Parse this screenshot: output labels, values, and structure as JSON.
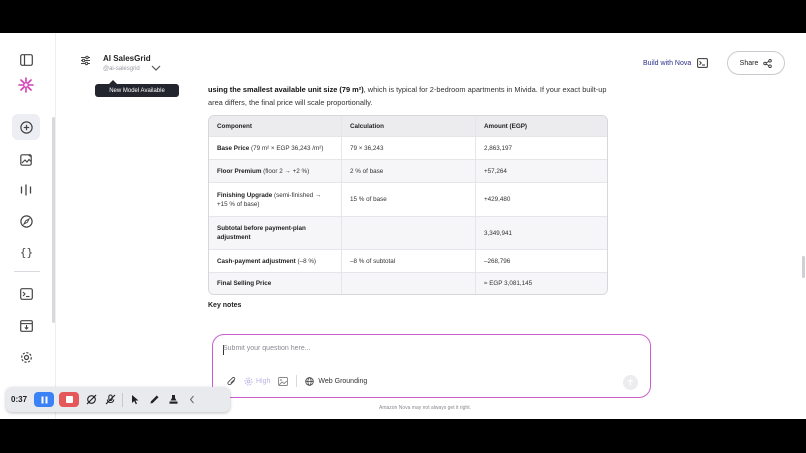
{
  "header": {
    "model_name": "AI SalesGrid",
    "model_handle": "@ai-salesgrid",
    "tooltip": "New Model Available",
    "build_with": "Build with Nova",
    "share_label": "Share"
  },
  "message": {
    "intro_bold": "using the smallest available unit size (79 m²)",
    "intro_rest": ", which is typical for 2-bedroom apartments in Mivida. If your exact built-up area differs, the final price will scale proportionally.",
    "table": {
      "headers": [
        "Component",
        "Calculation",
        "Amount (EGP)"
      ],
      "rows": [
        {
          "label": "Base Price",
          "detail": " (79 m² × EGP 36,243 /m²)",
          "calc": "79 × 36,243",
          "amount": "2,863,197"
        },
        {
          "label": "Floor Premium",
          "detail": " (floor 2 → +2 %)",
          "calc": "2 % of base",
          "amount": "+57,264"
        },
        {
          "label": "Finishing Upgrade",
          "detail": " (semi-finished → +15 % of base)",
          "calc": "15 % of base",
          "amount": "+429,480"
        },
        {
          "label": "Subtotal before payment-plan adjustment",
          "detail": "",
          "calc": "",
          "amount": "3,349,941"
        },
        {
          "label": "Cash-payment adjustment",
          "detail": " (–8 %)",
          "calc": "–8 % of subtotal",
          "amount": "–268,796"
        },
        {
          "label": "Final Selling Price",
          "detail": "",
          "calc": "",
          "amount": "≈ EGP 3,081,145"
        }
      ]
    },
    "key_notes": "Key notes"
  },
  "composer": {
    "placeholder": "Submit your question here...",
    "reasoning_level": "High",
    "web_grounding": "Web Grounding"
  },
  "disclaimer": "Amazon Nova may not always get it right.",
  "recorder": {
    "time": "0:37"
  },
  "colors": {
    "accent": "#2c2f8c",
    "composer_border": "#c95fcf",
    "logo": "#d63fb6",
    "record_pause": "#3b82f6",
    "record_stop": "#e4575b"
  }
}
